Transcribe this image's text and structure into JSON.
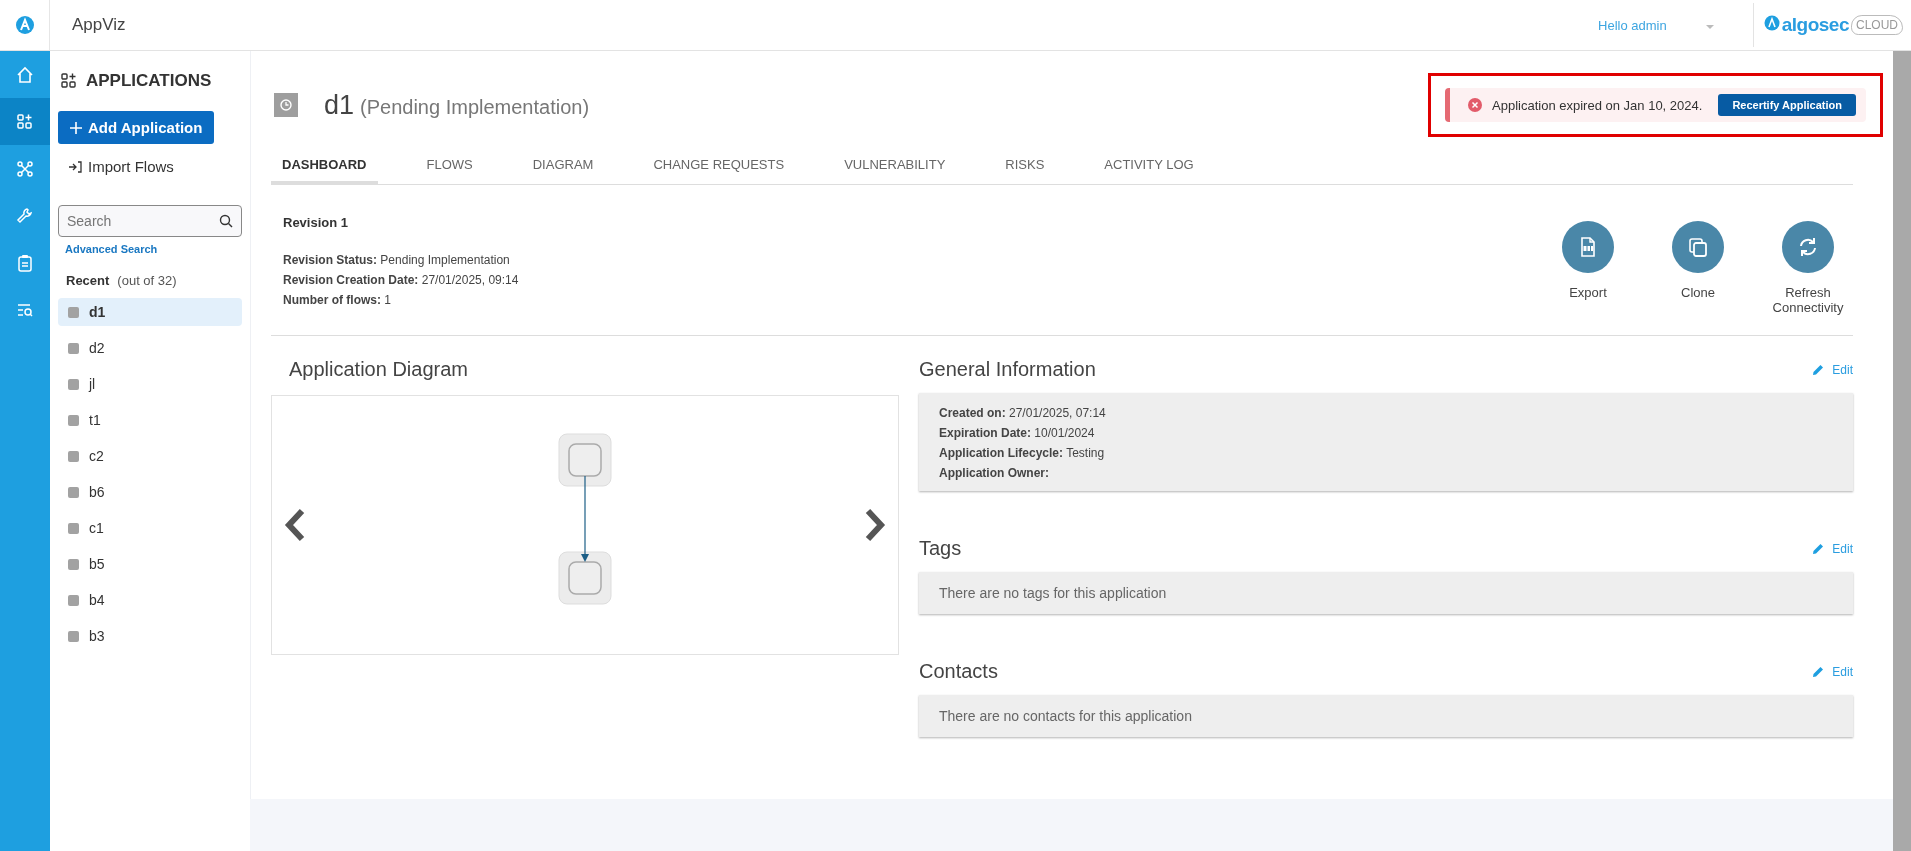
{
  "top_bar": {
    "app_title": "AppViz",
    "user_greeting": "Hello admin",
    "logo_text": "algosec",
    "logo_suffix": "CLOUD"
  },
  "nav_rail": [
    {
      "kind": "home",
      "selected": false
    },
    {
      "kind": "apps",
      "selected": true
    },
    {
      "kind": "network",
      "selected": false
    },
    {
      "kind": "wrench",
      "selected": false
    },
    {
      "kind": "clipboard",
      "selected": false
    },
    {
      "kind": "search-list",
      "selected": false
    }
  ],
  "sidebar": {
    "title": "APPLICATIONS",
    "add_button": "Add Application",
    "import_link": "Import Flows",
    "search": {
      "placeholder": "Search"
    },
    "advanced_search": "Advanced Search",
    "recent_label": "Recent",
    "recent_count": "(out of 32)",
    "items": [
      {
        "label": "d1",
        "selected": true
      },
      {
        "label": "d2",
        "selected": false
      },
      {
        "label": "jl",
        "selected": false
      },
      {
        "label": "t1",
        "selected": false
      },
      {
        "label": "c2",
        "selected": false
      },
      {
        "label": "b6",
        "selected": false
      },
      {
        "label": "c1",
        "selected": false
      },
      {
        "label": "b5",
        "selected": false
      },
      {
        "label": "b4",
        "selected": false
      },
      {
        "label": "b3",
        "selected": false
      }
    ]
  },
  "header": {
    "name": "d1",
    "status": "(Pending Implementation)"
  },
  "alert": {
    "message": "Application expired on Jan 10, 2024.",
    "button": "Recertify Application",
    "highlighted": true
  },
  "tabs": [
    {
      "label": "DASHBOARD",
      "selected": true
    },
    {
      "label": "FLOWS",
      "selected": false
    },
    {
      "label": "DIAGRAM",
      "selected": false
    },
    {
      "label": "CHANGE REQUESTS",
      "selected": false
    },
    {
      "label": "VULNERABILITY",
      "selected": false
    },
    {
      "label": "RISKS",
      "selected": false
    },
    {
      "label": "ACTIVITY LOG",
      "selected": false
    }
  ],
  "revision": {
    "title": "Revision 1",
    "fields": [
      "**Revision Status:** Pending Implementation",
      "**Revision Creation Date:** 27/01/2025, 09:14",
      "**Number of flows:** 1"
    ]
  },
  "actions": [
    {
      "kind": "pdf",
      "label": "Export"
    },
    {
      "kind": "clone",
      "label": "Clone"
    },
    {
      "kind": "refresh",
      "label": "Refresh Connectivity"
    }
  ],
  "diagram": {
    "title": "Application Diagram"
  },
  "general_info": {
    "title": "General Information",
    "edit": "Edit",
    "fields": [
      "**Created on:** 27/01/2025, 07:14",
      "**Expiration Date:** 10/01/2024",
      "**Application Lifecycle:** Testing",
      "**Application Owner:**"
    ]
  },
  "tags": {
    "title": "Tags",
    "edit": "Edit",
    "empty_text": "There are no tags for this application"
  },
  "contacts": {
    "title": "Contacts",
    "edit": "Edit",
    "empty_text": "There are no contacts for this application"
  }
}
